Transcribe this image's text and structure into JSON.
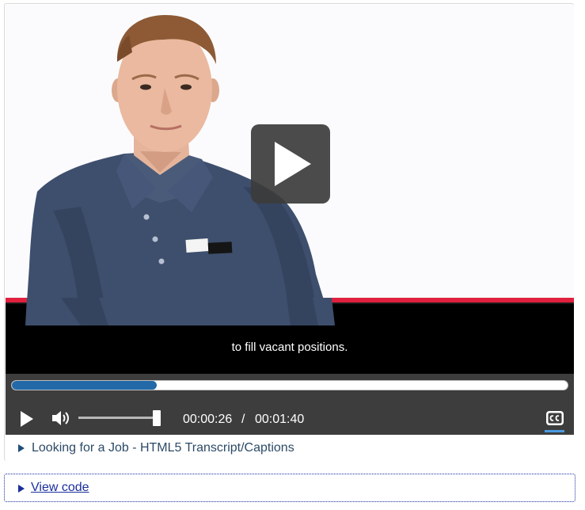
{
  "player": {
    "caption_text": "to fill vacant positions.",
    "progress": 0.26,
    "volume": 0.95,
    "current_time": "00:00:26",
    "time_separator": "/",
    "duration": "00:01:40",
    "play_icon": "play-icon",
    "volume_icon": "speaker-icon",
    "cc_icon": "closed-captions-icon",
    "seek_color": "#2369a8",
    "cc_active_color": "#4a9be0",
    "stripe_color": "#e0203e"
  },
  "transcript": {
    "label": "Looking for a Job - HTML5 Transcript/Captions"
  },
  "view_code": {
    "label": "View code"
  }
}
